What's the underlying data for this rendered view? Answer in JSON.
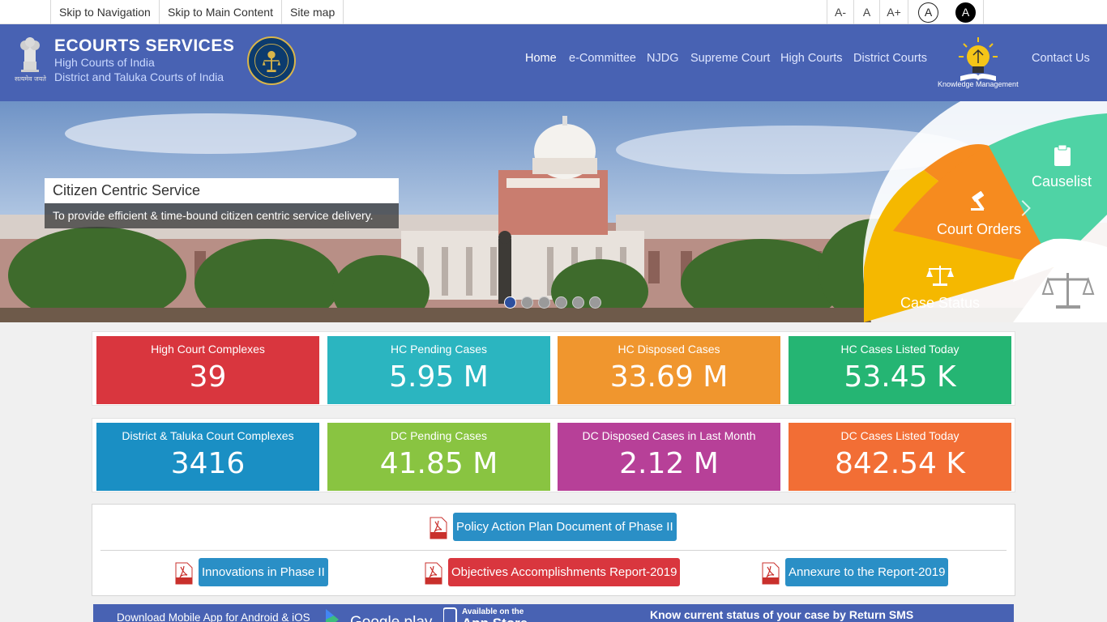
{
  "topbar": {
    "skip_nav": "Skip to Navigation",
    "skip_main": "Skip to Main Content",
    "sitemap": "Site map",
    "font_decrease": "A-",
    "font_normal": "A",
    "font_increase": "A+",
    "contrast_light": "A",
    "contrast_dark": "A"
  },
  "header": {
    "emblem_text": "सत्यमेव जयते",
    "title": "ECOURTS SERVICES",
    "subtitle1": "High Courts of India",
    "subtitle2": "District and Taluka Courts of India",
    "nav": {
      "home": "Home",
      "ecommittee": "e-Committee",
      "njdg": "NJDG",
      "supreme": "Supreme Court",
      "high": "High Courts",
      "district": "District Courts",
      "contact": "Contact Us"
    },
    "km_label": "Knowledge Management"
  },
  "banner": {
    "caption_title": "Citizen Centric Service",
    "caption_sub": "To provide efficient & time-bound citizen centric service delivery.",
    "wheel": {
      "causelist": "Causelist",
      "court_orders": "Court Orders",
      "case_status": "Case Status"
    },
    "slide_count": 6,
    "active_slide": 1
  },
  "stats": {
    "row1": [
      {
        "label": "High Court Complexes",
        "value": "39",
        "color": "#d9363e"
      },
      {
        "label": "HC Pending Cases",
        "value": "5.95 M",
        "color": "#2bb5c0"
      },
      {
        "label": "HC Disposed Cases",
        "value": "33.69 M",
        "color": "#f0962e"
      },
      {
        "label": "HC Cases Listed Today",
        "value": "53.45 K",
        "color": "#25b573"
      }
    ],
    "row2": [
      {
        "label": "District & Taluka Court Complexes",
        "value": "3416",
        "color": "#1a8fc4"
      },
      {
        "label": "DC Pending Cases",
        "value": "41.85 M",
        "color": "#89c441"
      },
      {
        "label": "DC Disposed Cases in Last Month",
        "value": "2.12 M",
        "color": "#b74098"
      },
      {
        "label": "DC Cases Listed Today",
        "value": "842.54 K",
        "color": "#f26e35"
      }
    ]
  },
  "documents": {
    "policy": "Policy Action Plan Document of Phase II",
    "innovations": "Innovations in Phase II",
    "objectives": "Objectives Accomplishments Report-2019",
    "annexure": "Annexure to the Report-2019",
    "pdf_label": "PDF"
  },
  "bottom": {
    "download_text": "Download Mobile App for Android & iOS",
    "google_play": "Google play",
    "app_store_top": "Available on the",
    "app_store": "App Store",
    "sms_text": "Know current status of your case by Return SMS"
  },
  "colors": {
    "header_bg": "#4862b3",
    "btn_blue": "#2a8fc6",
    "btn_red": "#d9363e"
  }
}
